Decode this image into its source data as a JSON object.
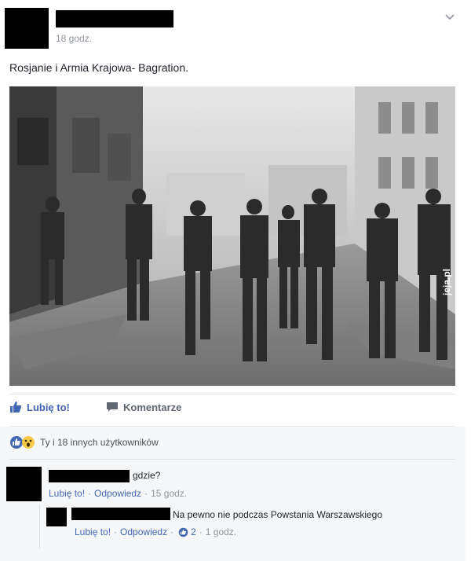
{
  "post": {
    "time": "18 godz.",
    "text": "Rosjanie i Armia Krajowa- Bagration.",
    "image_watermark": "jeja.pl"
  },
  "actions": {
    "like_label": "Lubię to!",
    "comment_label": "Komentarze"
  },
  "reactions": {
    "summary": "Ty i 18 innych użytkowników",
    "icons": [
      "like-icon",
      "wow-icon"
    ]
  },
  "comments": [
    {
      "text": "gdzie?",
      "like": "Lubię to!",
      "reply": "Odpowiedz",
      "time": "15 godz."
    },
    {
      "text": "Na pewno nie podczas Powstania Warszawskiego",
      "like": "Lubię to!",
      "reply": "Odpowiedz",
      "likes": "2",
      "time": "1 godz."
    }
  ],
  "colors": {
    "link": "#4267b2",
    "meta": "#90949c",
    "text": "#1d2129",
    "comments_bg": "#f6f7f9"
  }
}
